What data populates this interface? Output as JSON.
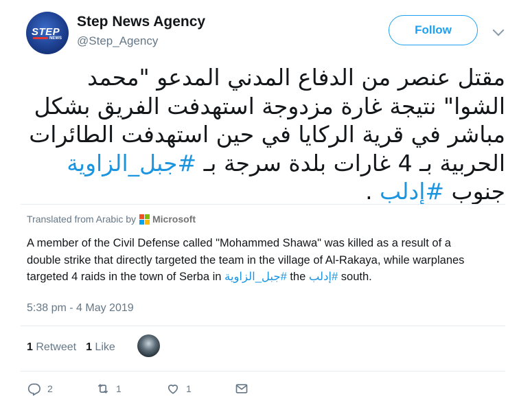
{
  "author": {
    "name": "Step News Agency",
    "handle": "@Step_Agency",
    "avatar_text": "STEP",
    "avatar_sub": "NEWS"
  },
  "follow": {
    "label": "Follow"
  },
  "tweet": {
    "text_line1": "مقتل عنصر من الدفاع المدني المدعو \"محمد",
    "text_line2": "الشوا\" نتيجة غارة مزدوجة استهدفت الفريق بشكل",
    "text_line3": "مباشر في قرية الركايا في حين استهدفت الطائرات",
    "text_line4_pre": "الحربية بـ 4 غارات بلدة سرجة بـ ",
    "hashtag1": "#جبل_الزاوية",
    "text_line5_pre": "جنوب ",
    "hashtag2": "#إدلب",
    "text_line5_post": " ."
  },
  "translation": {
    "label": "Translated from Arabic by",
    "provider": "Microsoft",
    "text_pre": "A member of the Civil Defense called \"Mohammed Shawa\" was killed as a result of a double strike that directly targeted the team in the village of Al-Rakaya, while warplanes targeted 4 raids in the town of Serba in ",
    "hashtag1": "#جبل_الزاوية",
    "text_mid": " the ",
    "hashtag2": "#إدلب",
    "text_post": " south."
  },
  "timestamp": "5:38 pm - 4 May 2019",
  "stats": {
    "retweets_count": "1",
    "retweets_label": "Retweet",
    "likes_count": "1",
    "likes_label": "Like"
  },
  "actions": {
    "reply_count": "2",
    "retweet_count": "1",
    "like_count": "1"
  },
  "colors": {
    "accent": "#1da1f2",
    "hashtag": "#1b95e0",
    "secondary_text": "#657786"
  }
}
